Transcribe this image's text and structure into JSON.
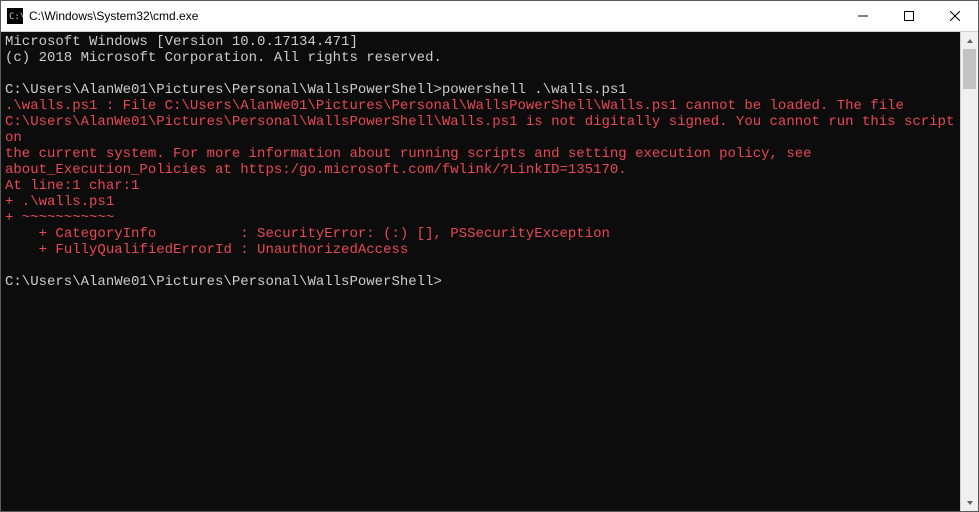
{
  "window": {
    "title": "C:\\Windows\\System32\\cmd.exe",
    "icon_name": "cmd-icon"
  },
  "terminal": {
    "line1": "Microsoft Windows [Version 10.0.17134.471]",
    "line2": "(c) 2018 Microsoft Corporation. All rights reserved.",
    "prompt1_path": "C:\\Users\\AlanWe01\\Pictures\\Personal\\WallsPowerShell>",
    "prompt1_cmd": "powershell .\\walls.ps1",
    "err1": ".\\walls.ps1 : File C:\\Users\\AlanWe01\\Pictures\\Personal\\WallsPowerShell\\Walls.ps1 cannot be loaded. The file",
    "err2": "C:\\Users\\AlanWe01\\Pictures\\Personal\\WallsPowerShell\\Walls.ps1 is not digitally signed. You cannot run this script on",
    "err3": "the current system. For more information about running scripts and setting execution policy, see",
    "err4": "about_Execution_Policies at https:/go.microsoft.com/fwlink/?LinkID=135170.",
    "err5": "At line:1 char:1",
    "err6": "+ .\\walls.ps1",
    "err7": "+ ~~~~~~~~~~~",
    "err8": "    + CategoryInfo          : SecurityError: (:) [], PSSecurityException",
    "err9": "    + FullyQualifiedErrorId : UnauthorizedAccess",
    "prompt2_path": "C:\\Users\\AlanWe01\\Pictures\\Personal\\WallsPowerShell>"
  }
}
